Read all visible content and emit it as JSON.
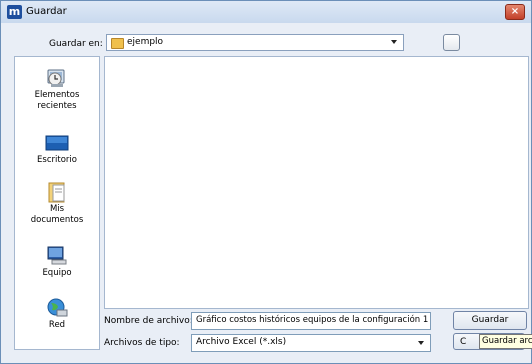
{
  "window": {
    "title": "Guardar",
    "close_glyph": "×",
    "app_icon_letter": "m"
  },
  "save_in": {
    "label": "Guardar en:",
    "value": "ejemplo"
  },
  "places": [
    {
      "label_line1": "Elementos",
      "label_line2": "recientes",
      "icon": "recent-items-icon"
    },
    {
      "label_line1": "Escritorio",
      "label_line2": "",
      "icon": "desktop-icon"
    },
    {
      "label_line1": "Mis",
      "label_line2": "documentos",
      "icon": "my-documents-icon"
    },
    {
      "label_line1": "Equipo",
      "label_line2": "",
      "icon": "computer-icon"
    },
    {
      "label_line1": "Red",
      "label_line2": "",
      "icon": "network-icon"
    }
  ],
  "filename": {
    "label": "Nombre de archivo:",
    "value": "Gráfico costos históricos equipos de la configuración 1"
  },
  "filetype": {
    "label": "Archivos de tipo:",
    "value": "Archivo Excel (*.xls)"
  },
  "buttons": {
    "save": "Guardar",
    "cancel_partial": "C"
  },
  "tooltip": {
    "text": "Guardar arc"
  }
}
